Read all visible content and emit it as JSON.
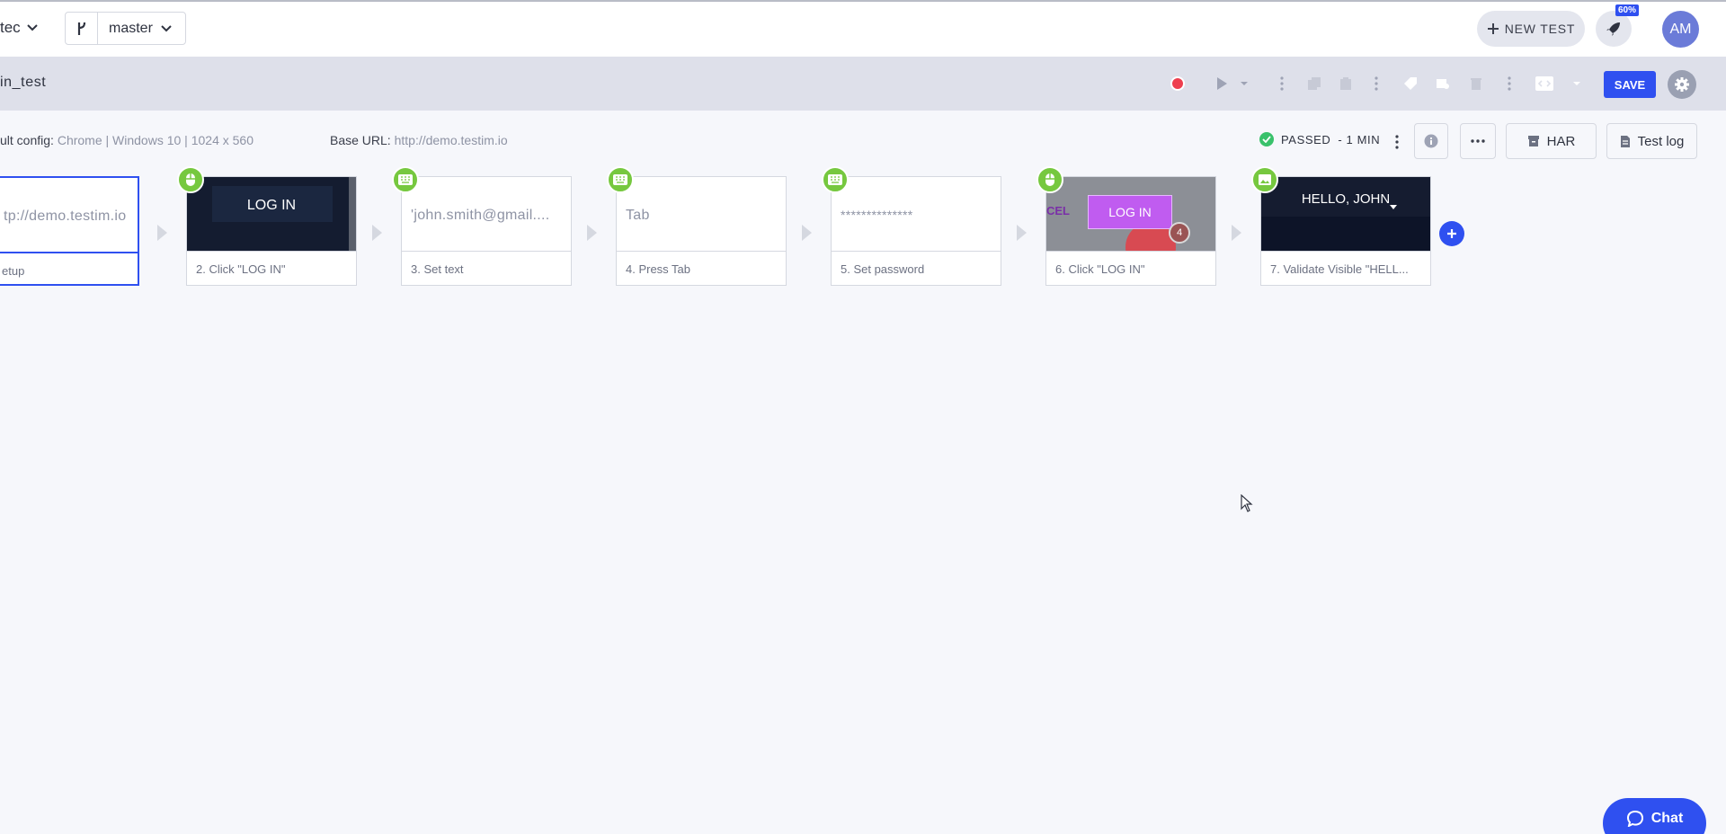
{
  "header": {
    "project_label": "tec",
    "branch_name": "master",
    "new_test_label": "NEW TEST",
    "progress_badge": "60%",
    "avatar_initials": "AM"
  },
  "toolbar": {
    "test_name": "in_test",
    "save_label": "SAVE"
  },
  "config": {
    "default_config_label": "ult config:",
    "default_config_value": "Chrome | Windows 10 | 1024 x 560",
    "base_url_label": "Base URL:",
    "base_url_value": "http://demo.testim.io"
  },
  "status": {
    "text": "PASSED",
    "duration": "- 1 MIN",
    "har_label": "HAR",
    "test_log_label": "Test log"
  },
  "steps": [
    {
      "thumb_text": "tp://demo.testim.io",
      "label": "etup",
      "type": "setup"
    },
    {
      "thumb_text": "LOG IN",
      "label": "2. Click \"LOG IN\"",
      "type": "click"
    },
    {
      "thumb_text": "'john.smith@gmail....",
      "label": "3. Set text",
      "type": "keyboard"
    },
    {
      "thumb_text": "Tab",
      "label": "4. Press Tab",
      "type": "keyboard"
    },
    {
      "thumb_text": "**************",
      "label": "5. Set password",
      "type": "keyboard"
    },
    {
      "thumb_text": "LOG IN",
      "thumb_extra_text": "CEL",
      "thumb_count": "4",
      "label": "6. Click \"LOG IN\"",
      "type": "click"
    },
    {
      "thumb_text": "HELLO, JOHN",
      "label": "7. Validate Visible \"HELL...",
      "type": "validate"
    }
  ],
  "chat": {
    "label": "Chat"
  },
  "colors": {
    "accent": "#2f50f0",
    "passed": "#39c16b",
    "step_badge": "#76c83f",
    "record": "#ee3f4f"
  }
}
